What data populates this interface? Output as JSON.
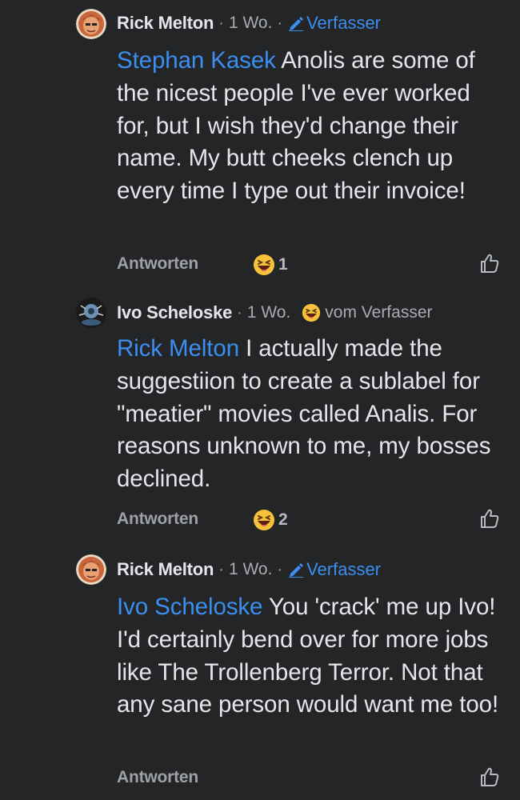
{
  "comments": [
    {
      "author": "Rick Melton",
      "separator1": "·",
      "time": "1 Wo.",
      "separator2": "·",
      "badge": "Verfasser",
      "mention": "Stephan Kasek",
      "text": " Anolis are some of the nicest people I've ever worked for, but I wish they'd change their name. My butt cheeks clench up every time I type out their invoice!",
      "reply_label": "Antworten",
      "reaction_count": "1",
      "avatar_icon": "rick-avatar",
      "reaction_icon": "laughing-emoji-icon"
    },
    {
      "author": "Ivo Scheloske",
      "separator1": "·",
      "time": "1 Wo.",
      "badge": "vom Verfasser",
      "mention": "Rick Melton",
      "text": " I actually made the suggestiion to create a sublabel for \"meatier\" movies called Analis. For reasons unknown to me, my bosses declined.",
      "reply_label": "Antworten",
      "reaction_count": "2",
      "avatar_icon": "ivo-avatar",
      "reaction_icon": "laughing-emoji-icon"
    },
    {
      "author": "Rick Melton",
      "separator1": "·",
      "time": "1 Wo.",
      "separator2": "·",
      "badge": "Verfasser",
      "mention": "Ivo Scheloske",
      "text": " You 'crack' me up Ivo! I'd certainly bend over for more jobs like The Trollenberg Terror. Not that any sane person would want me too!",
      "reply_label": "Antworten",
      "avatar_icon": "rick-avatar"
    }
  ],
  "colors": {
    "background": "#242526",
    "text": "#e4e6eb",
    "accent": "#3b8ff0",
    "muted": "#a8abaf"
  }
}
